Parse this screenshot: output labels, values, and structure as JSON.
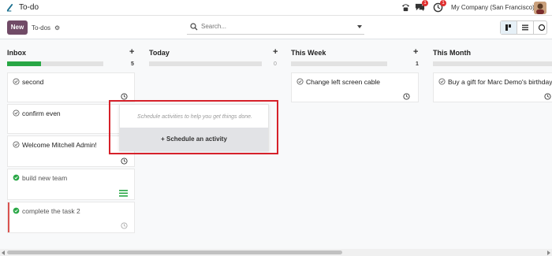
{
  "app": {
    "title": "To-do"
  },
  "topbar": {
    "chat_badge": "1",
    "activity_badge": "1",
    "company": "My Company (San Francisco)"
  },
  "control": {
    "new_label": "New",
    "breadcrumb": "To-dos",
    "search_placeholder": "Search..."
  },
  "columns": [
    {
      "title": "Inbox",
      "count": "5",
      "progress": 0.35
    },
    {
      "title": "Today",
      "count": "0",
      "progress": 0
    },
    {
      "title": "This Week",
      "count": "1",
      "progress": 0
    },
    {
      "title": "This Month",
      "count": "",
      "progress": 0
    }
  ],
  "cards": {
    "inbox": [
      {
        "title": "second"
      },
      {
        "title": "confirm even"
      },
      {
        "title": "Welcome Mitchell Admin!"
      },
      {
        "title": "build new team"
      },
      {
        "title": "complete the task 2"
      }
    ],
    "this_week": [
      {
        "title": "Change left screen cable"
      }
    ],
    "this_month": [
      {
        "title": "Buy a gift for Marc Demo's birthday"
      }
    ]
  },
  "popover": {
    "text": "Schedule activities to help you get things done.",
    "button": "+ Schedule an activity"
  },
  "colors": {
    "brand": "#714b67",
    "success": "#28a745",
    "highlight": "#d6212a"
  }
}
